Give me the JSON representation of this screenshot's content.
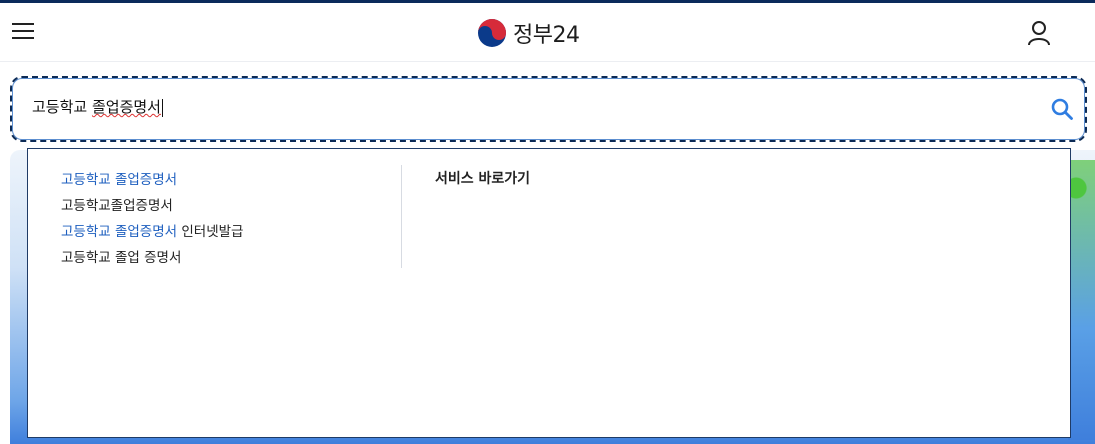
{
  "header": {
    "logo_text": "정부24",
    "menu_icon": "hamburger-menu-icon",
    "user_icon": "user-icon",
    "emblem_icon": "taegeuk-emblem-icon"
  },
  "search": {
    "value_plain": "고등학교 ",
    "value_underlined": "졸업증명서",
    "search_icon": "search-icon",
    "accent_color": "#1e5fbf"
  },
  "dropdown": {
    "suggestions": [
      {
        "highlight": "고등학교 졸업증명서",
        "rest": ""
      },
      {
        "highlight": "",
        "rest": "고등학교졸업증명서"
      },
      {
        "highlight": "고등학교 졸업증명서",
        "rest": " 인터넷발급"
      },
      {
        "highlight": "",
        "rest": "고등학교 졸업 증명서"
      }
    ],
    "quick_links_title": "서비스 바로가기"
  }
}
